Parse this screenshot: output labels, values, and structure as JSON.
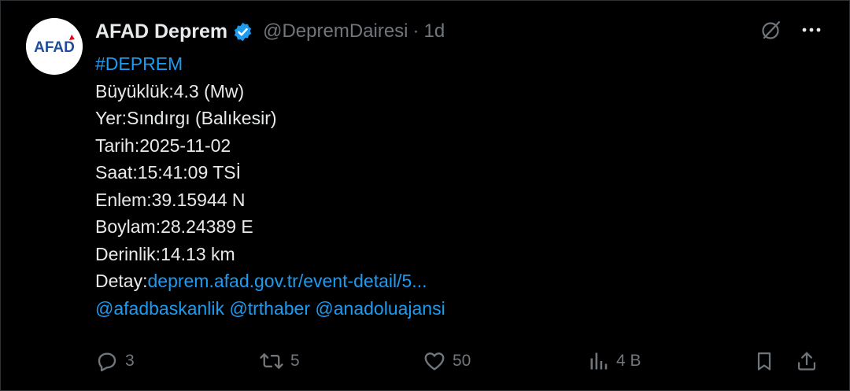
{
  "tweet": {
    "author": {
      "display_name": "AFAD Deprem",
      "handle": "@DepremDairesi",
      "verified": true,
      "avatar_text": "AFAD"
    },
    "separator": "·",
    "time": "1d",
    "lines": [
      {
        "label": "",
        "value": "#DEPREM",
        "value_link": true
      },
      {
        "label": "Büyüklük:",
        "value": "4.3 (Mw)",
        "value_link": false
      },
      {
        "label": "Yer:",
        "value": "Sındırgı (Balıkesir)",
        "value_link": false
      },
      {
        "label": "Tarih:",
        "value": "2025-11-02",
        "value_link": false
      },
      {
        "label": "Saat:",
        "value": "15:41:09 TSİ",
        "value_link": false
      },
      {
        "label": "Enlem:",
        "value": "39.15944 N",
        "value_link": false
      },
      {
        "label": "Boylam:",
        "value": "28.24389 E",
        "value_link": false
      },
      {
        "label": "Derinlik:",
        "value": "14.13 km",
        "value_link": false
      },
      {
        "label": "Detay:",
        "value": "deprem.afad.gov.tr/event-detail/5...",
        "value_link": true
      }
    ],
    "mentions": [
      "@afadbaskanlik",
      "@trthaber",
      "@anadoluajansi"
    ],
    "stats": {
      "replies": "3",
      "reposts": "5",
      "likes": "50",
      "views": "4 B"
    }
  },
  "colors": {
    "background": "#000000",
    "text": "#e7e9ea",
    "muted": "#71767b",
    "link": "#1d9bf0",
    "afad_red": "#e30613",
    "afad_blue": "#1e4c9a"
  },
  "icons": [
    "verified-badge-icon",
    "grok-icon",
    "more-icon",
    "reply-icon",
    "repost-icon",
    "like-icon",
    "views-icon",
    "bookmark-icon",
    "share-icon"
  ]
}
